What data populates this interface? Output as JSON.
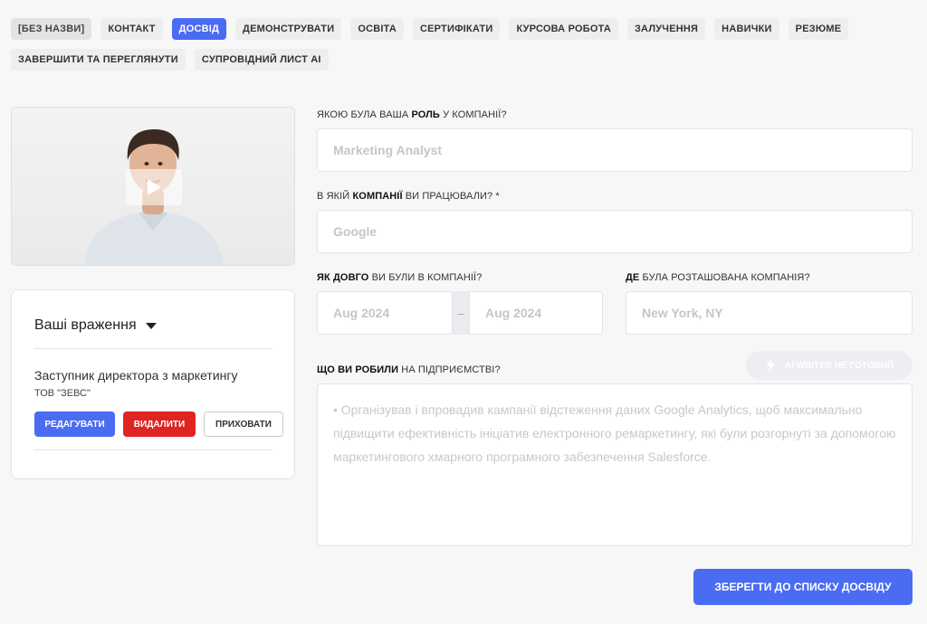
{
  "tabs": [
    {
      "label": "[БЕЗ НАЗВИ]"
    },
    {
      "label": "КОНТАКТ"
    },
    {
      "label": "ДОСВІД"
    },
    {
      "label": "ДЕМОНСТРУВАТИ"
    },
    {
      "label": "ОСВІТА"
    },
    {
      "label": "СЕРТИФІКАТИ"
    },
    {
      "label": "КУРСОВА РОБОТА"
    },
    {
      "label": "ЗАЛУЧЕННЯ"
    },
    {
      "label": "НАВИЧКИ"
    },
    {
      "label": "РЕЗЮМЕ"
    },
    {
      "label": "ЗАВЕРШИТИ ТА ПЕРЕГЛЯНУТИ"
    },
    {
      "label": "СУПРОВІДНИЙ ЛИСТ AI"
    }
  ],
  "active_tab": "ДОСВІД",
  "impressions": {
    "title": "Ваші враження",
    "job_title": "Заступник директора з маркетингу",
    "company": "ТОВ \"ЗЕВС\"",
    "edit_label": "РЕДАГУВАТИ",
    "delete_label": "ВИДАЛИТИ",
    "hide_label": "ПРИХОВАТИ"
  },
  "form": {
    "role": {
      "label_pre": "ЯКОЮ БУЛА ВАША ",
      "label_bold": "РОЛЬ",
      "label_post": " У КОМПАНІЇ?",
      "placeholder": "Marketing Analyst"
    },
    "company": {
      "label_pre": "В ЯКІЙ ",
      "label_bold": "КОМПАНІЇ",
      "label_post": " ВИ ПРАЦЮВАЛИ? *",
      "placeholder": "Google"
    },
    "duration": {
      "label_bold": "ЯК ДОВГО",
      "label_post": " ВИ БУЛИ В КОМПАНІЇ?",
      "start_placeholder": "Aug 2024",
      "separator": "–",
      "end_placeholder": "Aug 2024"
    },
    "location": {
      "label_bold": "ДЕ",
      "label_post": " БУЛА РОЗТАШОВАНА КОМПАНІЯ?",
      "placeholder": "New York, NY"
    },
    "duties": {
      "label_bold": "ЩО ВИ РОБИЛИ",
      "label_post": " НА ПІДПРИЄМСТВІ?",
      "placeholder": "• Організував і впровадив кампанії відстеження даних Google Analytics, щоб максимально підвищити ефективність ініціатив електронного ремаркетингу, які були розгорнуті за допомогою маркетингового хмарного програмного забезпечення Salesforce."
    },
    "ai_writer_label": "AI WRITER НЕ ГОТОВИЙ",
    "save_label": "ЗБЕРЕГТИ ДО СПИСКУ ДОСВІДУ"
  },
  "colors": {
    "accent": "#4a6cf2",
    "danger": "#e02424"
  }
}
